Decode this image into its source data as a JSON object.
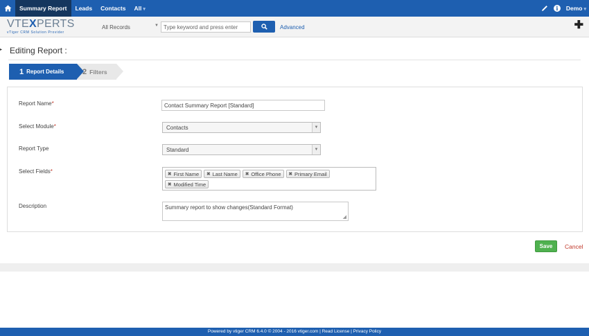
{
  "topnav": {
    "items": [
      {
        "label": "Summary Report",
        "active": true
      },
      {
        "label": "Leads",
        "active": false
      },
      {
        "label": "Contacts",
        "active": false
      },
      {
        "label": "All",
        "active": false
      }
    ],
    "user": "Demo",
    "colors": {
      "bar": "#1e5fb0",
      "active": "#15365e"
    }
  },
  "logo": {
    "main_prefix": "VTE",
    "main_x": "X",
    "main_suffix": "PERTS",
    "tagline": "vTiger CRM Solution Provider"
  },
  "search": {
    "scope": "All Records",
    "placeholder": "Type keyword and press enter",
    "advanced_label": "Advanced"
  },
  "page": {
    "title": "Editing Report :"
  },
  "steps": [
    {
      "num": "1",
      "label": "Report Details",
      "active": true
    },
    {
      "num": "2",
      "label": "Filters",
      "active": false
    }
  ],
  "form": {
    "report_name": {
      "label": "Report Name",
      "value": "Contact Summary Report [Standard]"
    },
    "module": {
      "label": "Select Module",
      "value": "Contacts"
    },
    "report_type": {
      "label": "Report Type",
      "value": "Standard"
    },
    "fields": {
      "label": "Select Fields",
      "chips": [
        "First Name",
        "Last Name",
        "Office Phone",
        "Primary Email",
        "Modified Time"
      ]
    },
    "description": {
      "label": "Description",
      "value": "Summary report to show changes(Standard Format)"
    }
  },
  "actions": {
    "save": "Save",
    "cancel": "Cancel"
  },
  "footer": {
    "text": "Powered by vtiger CRM 6.4.0  © 2004 - 2016  vtiger.com | Read License | Privacy Policy"
  },
  "icons": [
    "home-icon",
    "pencil-icon",
    "info-icon",
    "search-icon",
    "plus-icon",
    "chevron-down-icon",
    "remove-chip-icon"
  ]
}
